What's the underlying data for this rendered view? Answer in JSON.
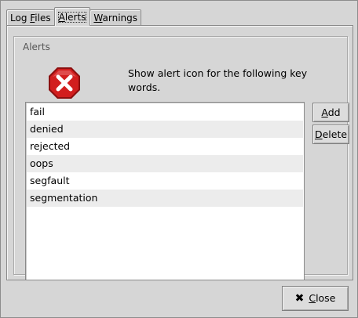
{
  "tabs": [
    {
      "label_pre": "Log ",
      "label_u": "F",
      "label_post": "iles"
    },
    {
      "label_pre": "",
      "label_u": "A",
      "label_post": "lerts"
    },
    {
      "label_pre": "",
      "label_u": "W",
      "label_post": "arnings"
    }
  ],
  "frame_label": "Alerts",
  "description": "Show alert icon for the following key words.",
  "alert_icon": "alert-stop-icon",
  "keywords": [
    "fail",
    "denied",
    "rejected",
    "oops",
    "segfault",
    "segmentation"
  ],
  "buttons": {
    "add_u": "A",
    "add_rest": "dd",
    "delete_u": "D",
    "delete_rest": "elete",
    "close_u": "C",
    "close_rest": "lose"
  },
  "colors": {
    "alert_red": "#d21e1e",
    "alt_row": "#ececec"
  }
}
